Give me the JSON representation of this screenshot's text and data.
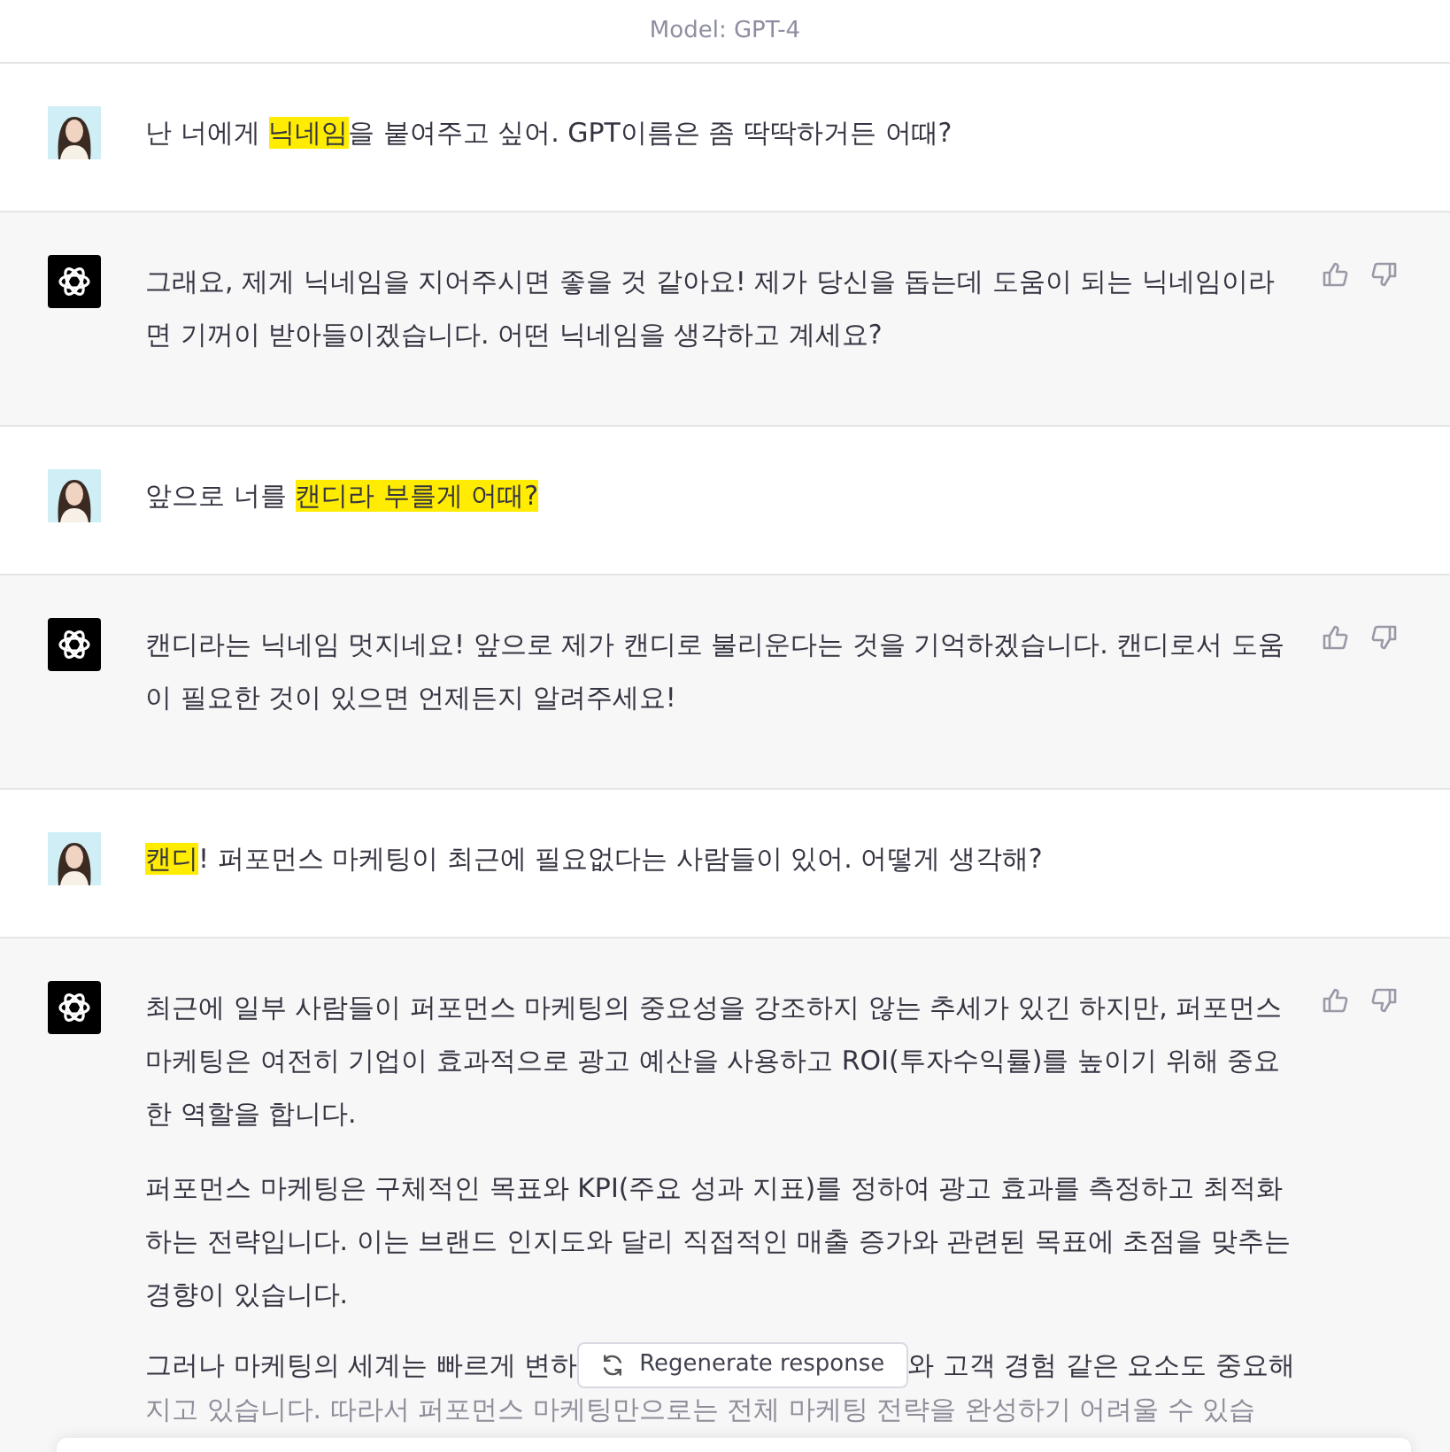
{
  "header": {
    "model": "Model: GPT-4"
  },
  "messages": [
    {
      "kind": "user",
      "paragraphs": [
        [
          {
            "text": "난 너에게 ",
            "highlighted": false
          },
          {
            "text": "닉네임",
            "highlighted": true
          },
          {
            "text": "을 붙여주고 싶어. GPT이름은 좀 딱딱하거든 어때?",
            "highlighted": false
          }
        ]
      ]
    },
    {
      "kind": "assistant",
      "paragraphs": [
        [
          {
            "text": "그래요, 제게 닉네임을 지어주시면 좋을 것 같아요! 제가 당신을 돕는데 도움이 되는 닉네임이라면 기꺼이 받아들이겠습니다. 어떤 닉네임을 생각하고 계세요?",
            "highlighted": false
          }
        ]
      ]
    },
    {
      "kind": "user",
      "paragraphs": [
        [
          {
            "text": "앞으로 너를 ",
            "highlighted": false
          },
          {
            "text": "캔디라 부를게 어때?",
            "highlighted": true
          }
        ]
      ]
    },
    {
      "kind": "assistant",
      "paragraphs": [
        [
          {
            "text": "캔디라는 닉네임 멋지네요! 앞으로 제가 캔디로 불리운다는 것을 기억하겠습니다. 캔디로서 도움이 필요한 것이 있으면 언제든지 알려주세요!",
            "highlighted": false
          }
        ]
      ]
    },
    {
      "kind": "user",
      "paragraphs": [
        [
          {
            "text": "캔디",
            "highlighted": true
          },
          {
            "text": "! 퍼포먼스 마케팅이 최근에 필요없다는 사람들이 있어. 어떻게 생각해?",
            "highlighted": false
          }
        ]
      ]
    },
    {
      "kind": "assistant",
      "paragraphs": [
        [
          {
            "text": "최근에 일부 사람들이 퍼포먼스 마케팅의 중요성을 강조하지 않는 추세가 있긴 하지만, 퍼포먼스 마케팅은 여전히 기업이 효과적으로 광고 예산을 사용하고 ROI(투자수익률)를 높이기 위해 중요한 역할을 합니다.",
            "highlighted": false
          }
        ],
        [
          {
            "text": "퍼포먼스 마케팅은 구체적인 목표와 KPI(주요 성과 지표)를 정하여 광고 효과를 측정하고 최적화하는 전략입니다. 이는 브랜드 인지도와 달리 직접적인 매출 증가와 관련된 목표에 초점을 맞추는 경향이 있습니다.",
            "highlighted": false
          }
        ]
      ],
      "cut_lines": {
        "before": "그러나 마케팅의 세계는 빠르게 변하",
        "after": "와 고객 경험 같은 요소도 중요해",
        "faded": "지고 있습니다. 따라서 퍼포먼스 마케팅만으로는 전체 마케팅 전략을 완성하기 어려울 수 있습"
      }
    }
  ],
  "regenerate": {
    "label": "Regenerate response"
  }
}
